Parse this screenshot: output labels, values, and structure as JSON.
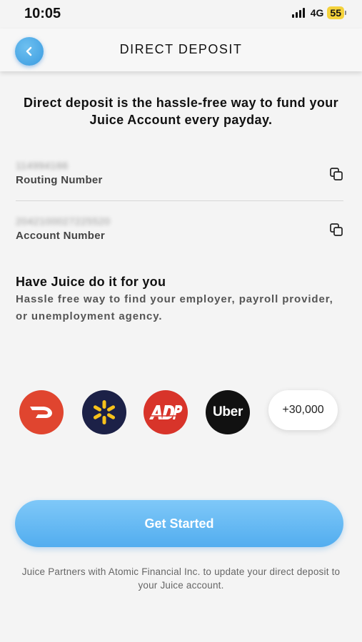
{
  "status_bar": {
    "time": "10:05",
    "network": "4G",
    "battery": "55"
  },
  "header": {
    "title": "DIRECT DEPOSIT"
  },
  "intro": {
    "text": "Direct deposit is the hassle-free way to fund your Juice Account every payday."
  },
  "routing": {
    "value": "114994166",
    "label": "Routing Number"
  },
  "account": {
    "value": "204210002722552​0",
    "label": "Account Number"
  },
  "juice_section": {
    "title": "Have Juice do it for you",
    "subtitle": "Hassle free way to find your employer, payroll provider, or unemployment agency."
  },
  "partners": {
    "items": [
      {
        "name": "doordash-logo-icon",
        "color": "#e0452f"
      },
      {
        "name": "walmart-logo-icon",
        "color": "#1c2147"
      },
      {
        "name": "adp-logo-icon",
        "color": "#d8342a"
      },
      {
        "name": "uber-logo-icon",
        "color": "#111111",
        "text": "Uber"
      }
    ],
    "more_label": "+30,000"
  },
  "cta": {
    "label": "Get Started",
    "color": "#5cb3f1"
  },
  "disclaimer": {
    "text": "Juice Partners with Atomic Financial Inc. to update your direct deposit to your Juice account."
  },
  "icons": {
    "back": "chevron-left-icon",
    "copy": "copy-icon"
  },
  "colors": {
    "accent": "#4aa6ea",
    "background": "#f4f4f4"
  }
}
